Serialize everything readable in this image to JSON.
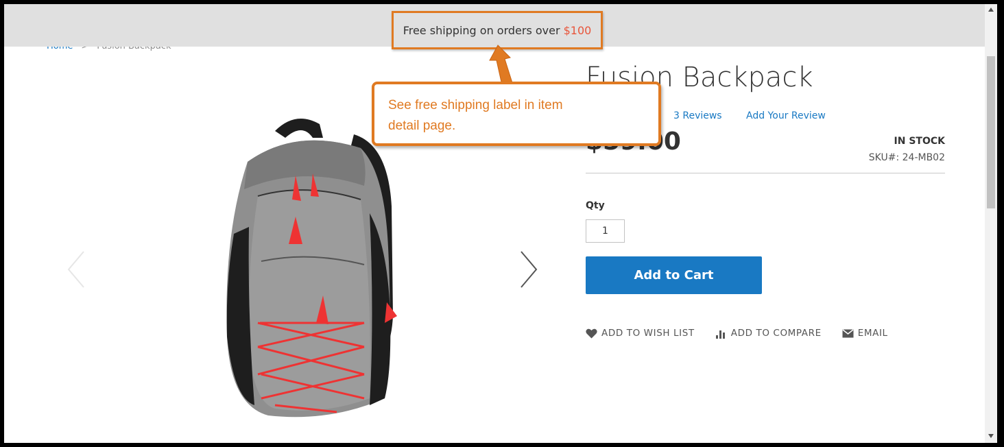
{
  "breadcrumb": {
    "home": "Home",
    "separator": ">",
    "current": "Fusion Backpack"
  },
  "shipping_banner": {
    "text": "Free shipping on orders over",
    "amount": "$100"
  },
  "callout": {
    "line1": "See free shipping label in item",
    "line2": "detail page."
  },
  "product": {
    "title": "Fusion Backpack",
    "reviews": "3  Reviews",
    "add_review": "Add Your Review",
    "price": "$59.00",
    "stock": "IN STOCK",
    "sku": "SKU#:  24-MB02",
    "qty_label": "Qty",
    "qty_value": "1",
    "add_to_cart": "Add to Cart"
  },
  "actions": {
    "wishlist": "ADD TO WISH LIST",
    "compare": "ADD TO COMPARE",
    "email": "EMAIL"
  },
  "colors": {
    "accent": "#1979c3",
    "callout": "#e07a22",
    "shipping_amount": "#e8553b"
  }
}
